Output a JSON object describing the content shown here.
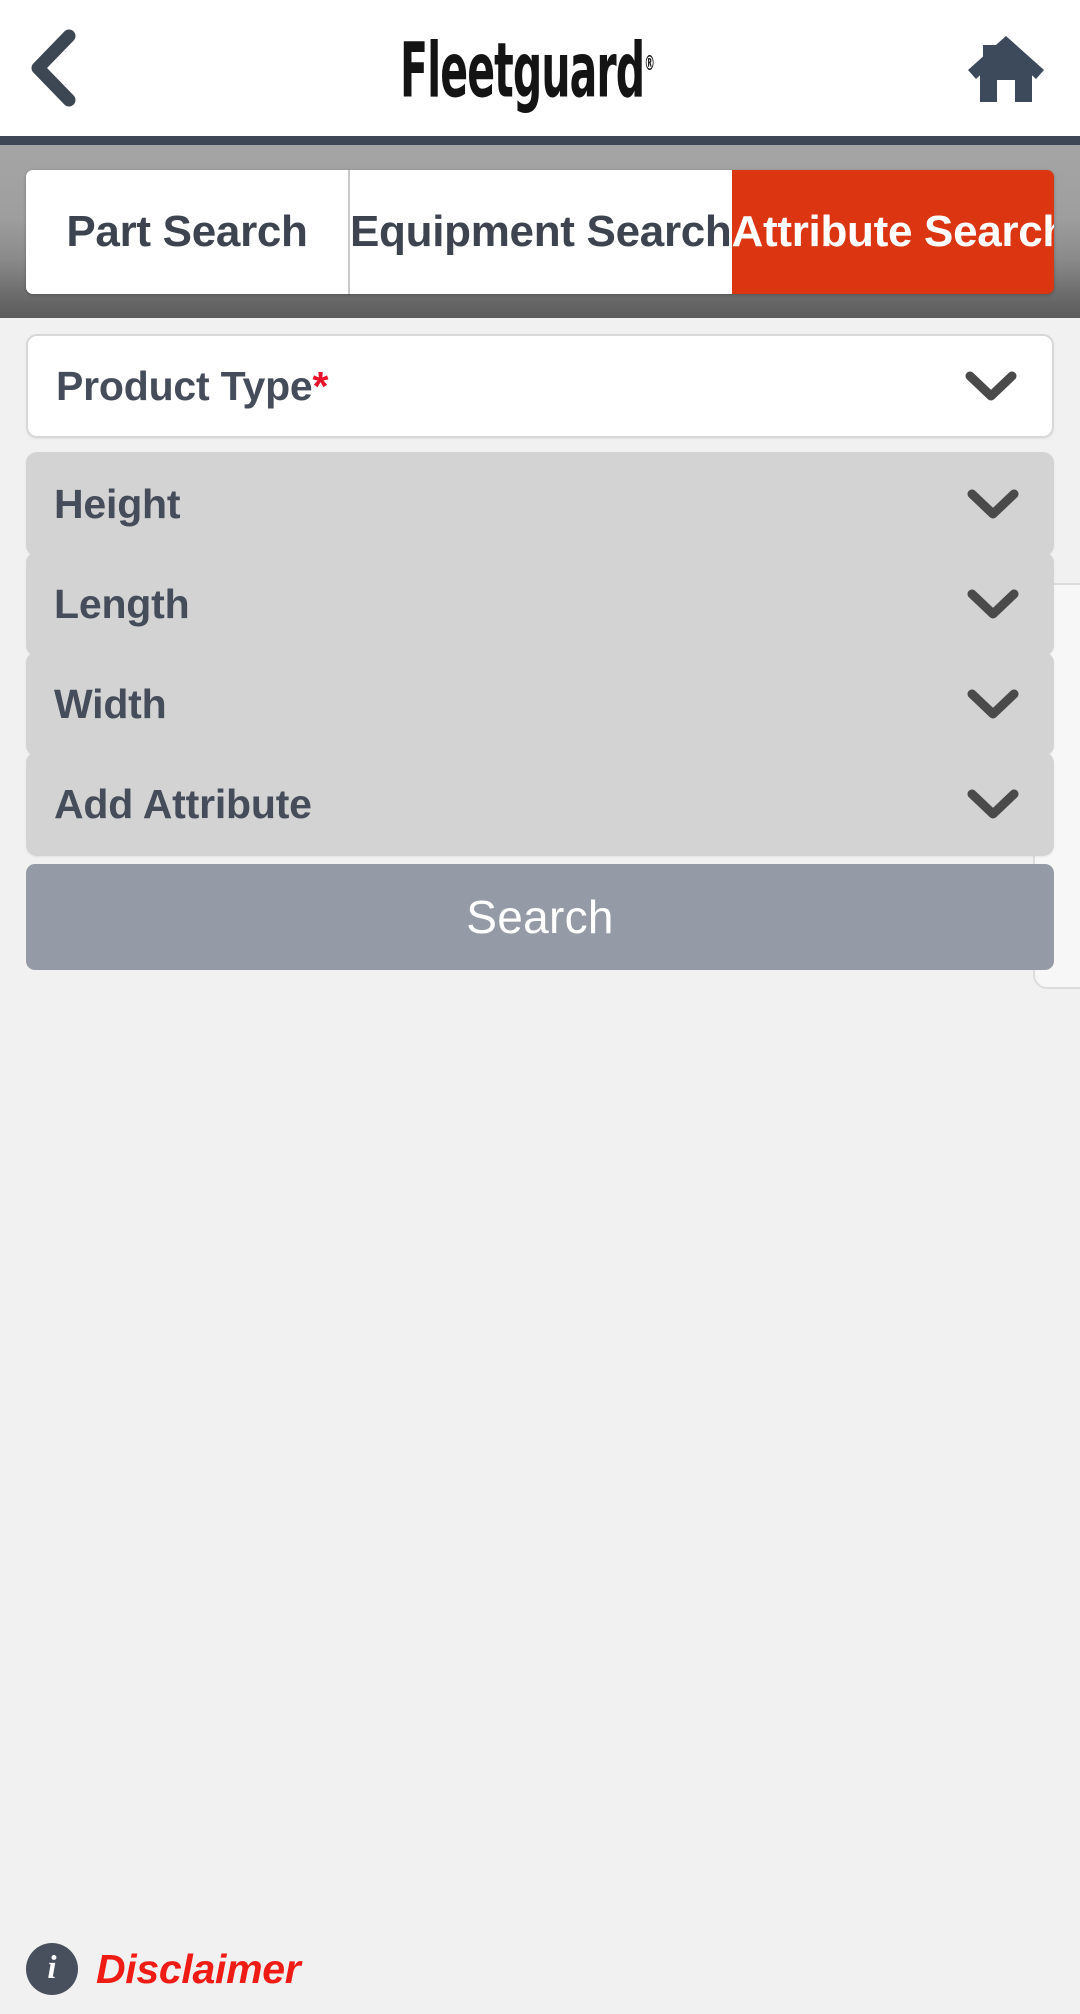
{
  "header": {
    "back_icon": "chevron-left-icon",
    "brand": "Fleetguard",
    "brand_mark": "®",
    "home_icon": "home-icon"
  },
  "tabs": {
    "items": [
      {
        "label": "Part Search",
        "active": false
      },
      {
        "label": "Equipment Search",
        "active": false
      },
      {
        "label": "Attribute Search",
        "active": true
      }
    ],
    "active_bg": "#dc3512",
    "inactive_bg": "#ffffff",
    "inactive_text": "#3d4450"
  },
  "form": {
    "fields": [
      {
        "label": "Product Type",
        "required_mark": "*",
        "enabled": true,
        "icon": "chevron-down-icon"
      },
      {
        "label": "Height",
        "required_mark": "",
        "enabled": false,
        "icon": "chevron-down-icon"
      },
      {
        "label": "Length",
        "required_mark": "",
        "enabled": false,
        "icon": "chevron-down-icon"
      },
      {
        "label": "Width",
        "required_mark": "",
        "enabled": false,
        "icon": "chevron-down-icon"
      },
      {
        "label": "Add Attribute",
        "required_mark": "",
        "enabled": false,
        "icon": "chevron-down-icon"
      }
    ],
    "search_label": "Search",
    "search_bg": "#949ba6",
    "required_color": "#e8132b"
  },
  "footer": {
    "info_icon": "info-icon",
    "info_glyph": "i",
    "disclaimer_label": "Disclaimer",
    "disclaimer_color": "#ef1c16"
  }
}
